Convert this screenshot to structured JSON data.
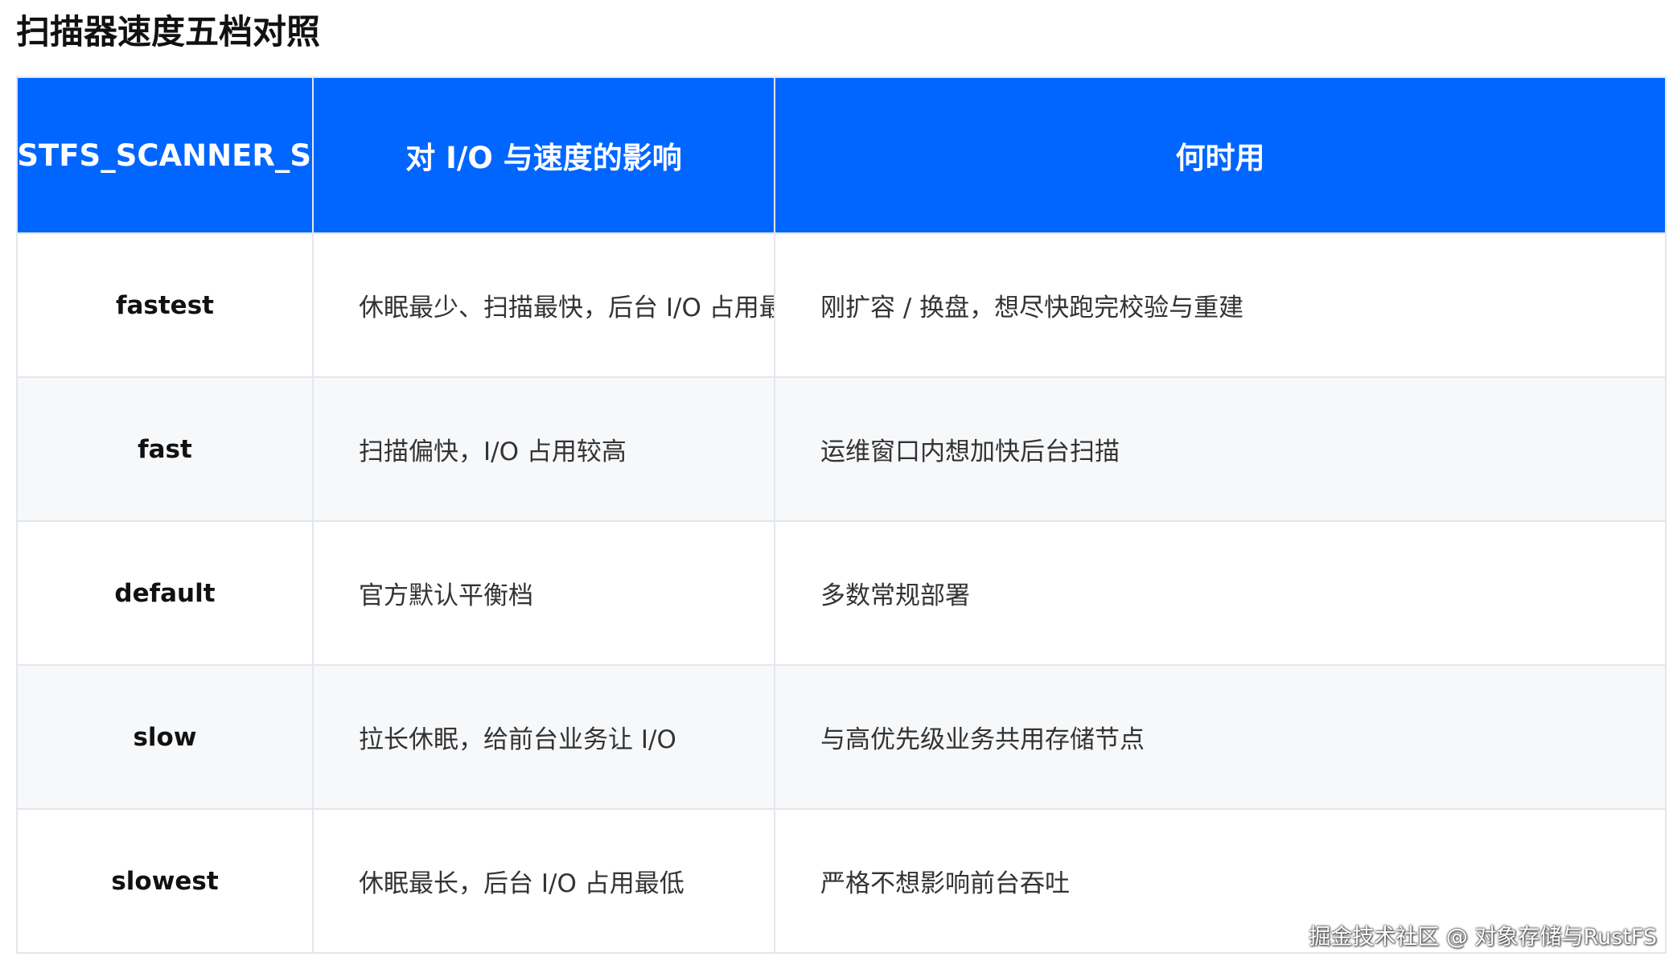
{
  "title": "扫描器速度五档对照",
  "table": {
    "headers": [
      "RUSTFS_SCANNER_S",
      "对 I/O 与速度的影响",
      "何时用"
    ],
    "rows": [
      {
        "level": "fastest",
        "impact": "休眠最少、扫描最快，后台 I/O 占用最",
        "when": "刚扩容 / 换盘，想尽快跑完校验与重建"
      },
      {
        "level": "fast",
        "impact": "扫描偏快，I/O 占用较高",
        "when": "运维窗口内想加快后台扫描"
      },
      {
        "level": "default",
        "impact": "官方默认平衡档",
        "when": "多数常规部署"
      },
      {
        "level": "slow",
        "impact": "拉长休眠，给前台业务让 I/O",
        "when": "与高优先级业务共用存储节点"
      },
      {
        "level": "slowest",
        "impact": "休眠最长，后台 I/O 占用最低",
        "when": "严格不想影响前台吞吐"
      }
    ]
  },
  "watermark": "掘金技术社区 @ 对象存储与RustFS",
  "colors": {
    "header_bg": "#0066ff",
    "header_text": "#ffffff",
    "stripe_bg": "#f7f8fa",
    "border": "#e3e6ea"
  }
}
